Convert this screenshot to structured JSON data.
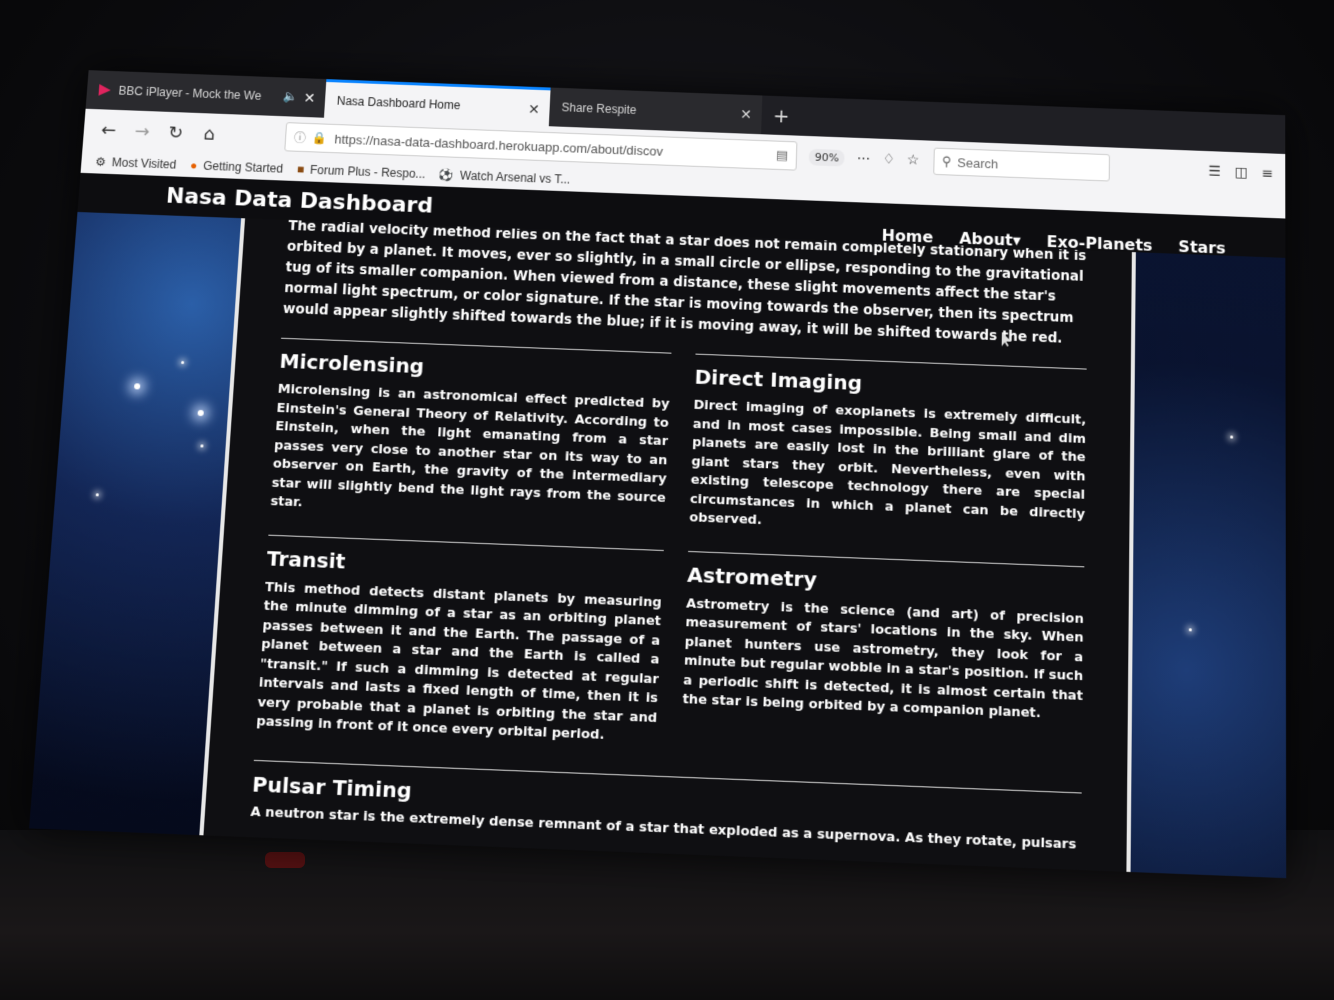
{
  "browser": {
    "tabs": [
      {
        "title": "BBC iPlayer - Mock the We"
      },
      {
        "title": "Nasa Dashboard Home"
      },
      {
        "title": "Share Respite"
      }
    ],
    "url": "https://nasa-data-dashboard.herokuapp.com/about/discov",
    "zoom": "90%",
    "search_placeholder": "Search",
    "bookmarks": [
      {
        "label": "Most Visited"
      },
      {
        "label": "Getting Started"
      },
      {
        "label": "Forum Plus - Respo..."
      },
      {
        "label": "Watch Arsenal vs T..."
      }
    ]
  },
  "site": {
    "title": "Nasa Data Dashboard",
    "nav": {
      "home": "Home",
      "about": "About",
      "exo": "Exo-Planets",
      "stars": "Stars"
    }
  },
  "intro": "The radial velocity method relies on the fact that a star does not remain completely stationary when it is orbited by a planet. It moves, ever so slightly, in a small circle or ellipse, responding to the gravitational tug of its smaller companion. When viewed from a distance, these slight movements affect the star's normal light spectrum, or color signature. If the star is moving towards the observer, then its spectrum would appear slightly shifted towards the blue; if it is moving away, it will be shifted towards the red.",
  "sections": {
    "microlensing": {
      "title": "Microlensing",
      "text": "Microlensing is an astronomical effect predicted by Einstein's General Theory of Relativity. According to Einstein, when the light emanating from a star passes very close to another star on its way to an observer on Earth, the gravity of the intermediary star will slightly bend the light rays from the source star."
    },
    "direct_imaging": {
      "title": "Direct Imaging",
      "text": "Direct imaging of exoplanets is extremely difficult, and in most cases impossible. Being small and dim planets are easily lost in the brilliant glare of the giant stars they orbit. Nevertheless, even with existing telescope technology there are special circumstances in which a planet can be directly observed."
    },
    "transit": {
      "title": "Transit",
      "text": "This method detects distant planets by measuring the minute dimming of a star as an orbiting planet passes between it and the Earth. The passage of a planet between a star and the Earth is called a \"transit.\" If such a dimming is detected at regular intervals and lasts a fixed length of time, then it is very probable that a planet is orbiting the star and passing in front of it once every orbital period."
    },
    "astrometry": {
      "title": "Astrometry",
      "text": "Astrometry is the science (and art) of precision measurement of stars' locations in the sky. When planet hunters use astrometry, they look for a minute but regular wobble in a star's position. If such a periodic shift is detected, it is almost certain that the star is being orbited by a companion planet."
    },
    "pulsar": {
      "title": "Pulsar Timing",
      "text": "A neutron star is the extremely dense remnant of a star that exploded as a supernova. As they rotate, pulsars"
    }
  }
}
